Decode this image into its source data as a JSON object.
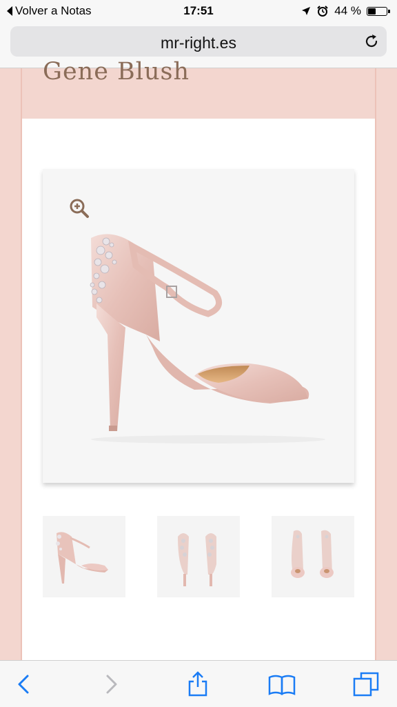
{
  "status_bar": {
    "back_label": "Volver a Notas",
    "time": "17:51",
    "battery": "44 %",
    "battery_level": 0.44
  },
  "browser": {
    "url": "mr-right.es"
  },
  "product": {
    "title": "Gene Blush"
  },
  "colors": {
    "page_background": "#f3d6cf",
    "title_color": "#8a6c58",
    "ios_blue": "#1a7cf5",
    "shoe_pink": "#ecc9c3"
  },
  "icons": {
    "zoom": "magnifier-plus-icon",
    "back": "chevron-left-icon",
    "forward": "chevron-right-icon",
    "share": "share-icon",
    "bookmarks": "book-icon",
    "tabs": "tabs-icon"
  }
}
